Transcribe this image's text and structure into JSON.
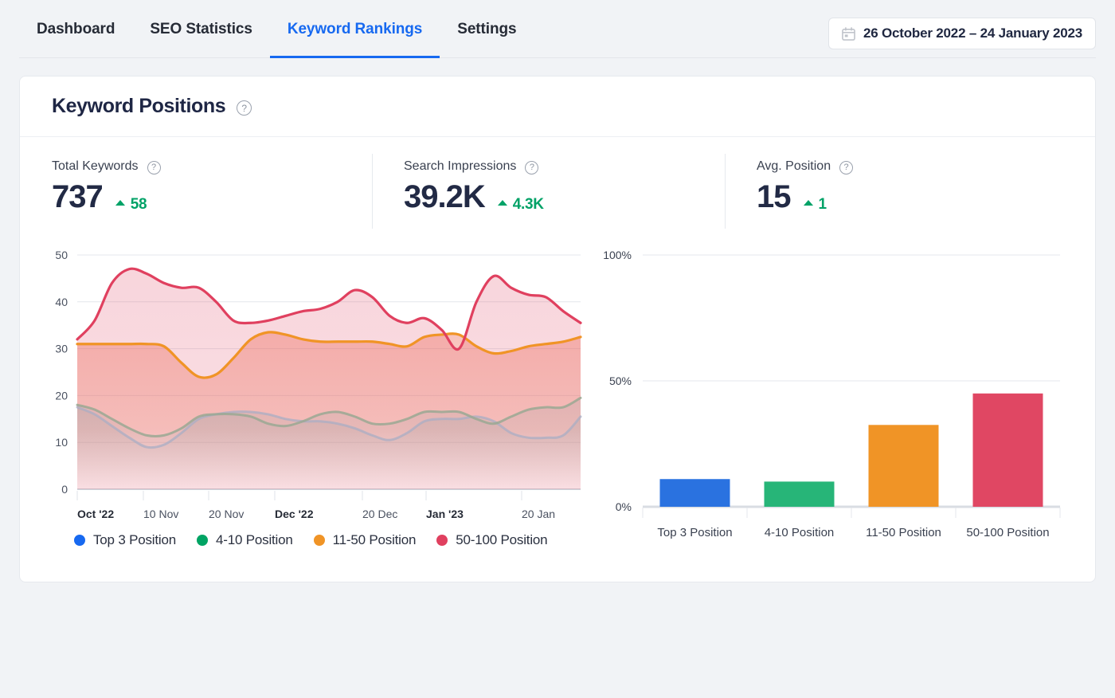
{
  "nav": {
    "tabs": [
      {
        "label": "Dashboard",
        "active": false
      },
      {
        "label": "SEO Statistics",
        "active": false
      },
      {
        "label": "Keyword Rankings",
        "active": true
      },
      {
        "label": "Settings",
        "active": false
      }
    ],
    "date_range": {
      "label": "26 October 2022 – 24 January 2023",
      "icon": "calendar-icon"
    }
  },
  "card": {
    "title": "Keyword Positions",
    "help_icon": "question-mark-icon"
  },
  "stats": [
    {
      "label": "Total Keywords",
      "value": "737",
      "delta": "58",
      "delta_direction": "up",
      "delta_color": "#00a267"
    },
    {
      "label": "Search Impressions",
      "value": "39.2K",
      "delta": "4.3K",
      "delta_direction": "up",
      "delta_color": "#00a267"
    },
    {
      "label": "Avg. Position",
      "value": "15",
      "delta": "1",
      "delta_direction": "up",
      "delta_color": "#00a267"
    }
  ],
  "legend": [
    {
      "label": "Top 3 Position",
      "color": "#1769f0"
    },
    {
      "label": "4-10 Position",
      "color": "#00a464"
    },
    {
      "label": "11-50 Position",
      "color": "#f09426"
    },
    {
      "label": "50-100 Position",
      "color": "#e0405f"
    }
  ],
  "colors": {
    "blue": "#2a72e0",
    "green": "#27b578",
    "orange": "#f09426",
    "pink": "#e04763",
    "grid": "#e4e7ec",
    "axis": "#cfd4db"
  },
  "chart_data": [
    {
      "type": "area",
      "title": "Keyword Positions over time",
      "id": "keyword-positions-timeseries",
      "xlabel": "",
      "ylabel": "",
      "ylim": [
        0,
        50
      ],
      "yticks": [
        0,
        10,
        20,
        30,
        40,
        50
      ],
      "grid": true,
      "legend_position": "bottom",
      "xticks": [
        {
          "label": "Oct '22",
          "bold": true
        },
        {
          "label": "10 Nov",
          "bold": false
        },
        {
          "label": "20 Nov",
          "bold": false
        },
        {
          "label": "Dec '22",
          "bold": true
        },
        {
          "label": "20 Dec",
          "bold": false
        },
        {
          "label": "Jan '23",
          "bold": true
        },
        {
          "label": "20 Jan",
          "bold": false
        }
      ],
      "x": [
        0,
        1,
        2,
        3,
        4,
        5,
        6,
        7,
        8,
        9,
        10,
        11,
        12,
        13,
        14,
        15,
        16,
        17,
        18,
        19,
        20,
        21,
        22,
        23,
        24
      ],
      "series": [
        {
          "name": "50-100 Position",
          "color": "#e0405f",
          "values": [
            32,
            36,
            44,
            47,
            46,
            44,
            43,
            43,
            40,
            36,
            35.5,
            36,
            37,
            38,
            38.5,
            40,
            42.5,
            41,
            37,
            35.5,
            36.5,
            34,
            30,
            40,
            45.5,
            43,
            41.5,
            41,
            38,
            35.5
          ]
        },
        {
          "name": "11-50 Position",
          "color": "#f09426",
          "values": [
            31,
            31,
            31,
            31,
            31,
            30.5,
            27,
            24,
            24.5,
            28,
            32,
            33.5,
            33,
            32,
            31.5,
            31.5,
            31.5,
            31.5,
            31,
            30.5,
            32.5,
            33,
            33,
            30.5,
            29,
            29.5,
            30.5,
            31,
            31.5,
            32.5
          ]
        },
        {
          "name": "4-10 Position",
          "color": "#27b578",
          "values": [
            18,
            17,
            15,
            13,
            11.5,
            11.5,
            13,
            15.5,
            16,
            16,
            15.5,
            14,
            13.5,
            14.5,
            16,
            16.5,
            15.5,
            14,
            14,
            15,
            16.5,
            16.5,
            16.5,
            15,
            14,
            15.5,
            17,
            17.5,
            17.5,
            19.5
          ]
        },
        {
          "name": "Top 3 Position",
          "color": "#2a72e0",
          "values": [
            17.5,
            16,
            13.5,
            11,
            9,
            9.5,
            12,
            15,
            16,
            16.5,
            16.5,
            16,
            15,
            14.5,
            14.5,
            14,
            13,
            11.5,
            10.5,
            12,
            14.5,
            15,
            15,
            15.5,
            14.5,
            12,
            11,
            11,
            11.5,
            15.5
          ]
        }
      ]
    },
    {
      "type": "bar",
      "title": "Keyword distribution by position bucket",
      "id": "keyword-position-distribution",
      "xlabel": "",
      "ylabel": "",
      "ylim": [
        0,
        100
      ],
      "yticks": [
        0,
        50,
        100
      ],
      "ytick_labels": [
        "0%",
        "50%",
        "100%"
      ],
      "grid": true,
      "categories": [
        "Top 3 Position",
        "4-10 Position",
        "11-50 Position",
        "50-100 Position"
      ],
      "values": [
        11,
        10,
        32.5,
        45
      ],
      "colors": [
        "#2a72e0",
        "#27b578",
        "#f09426",
        "#e04763"
      ]
    }
  ]
}
